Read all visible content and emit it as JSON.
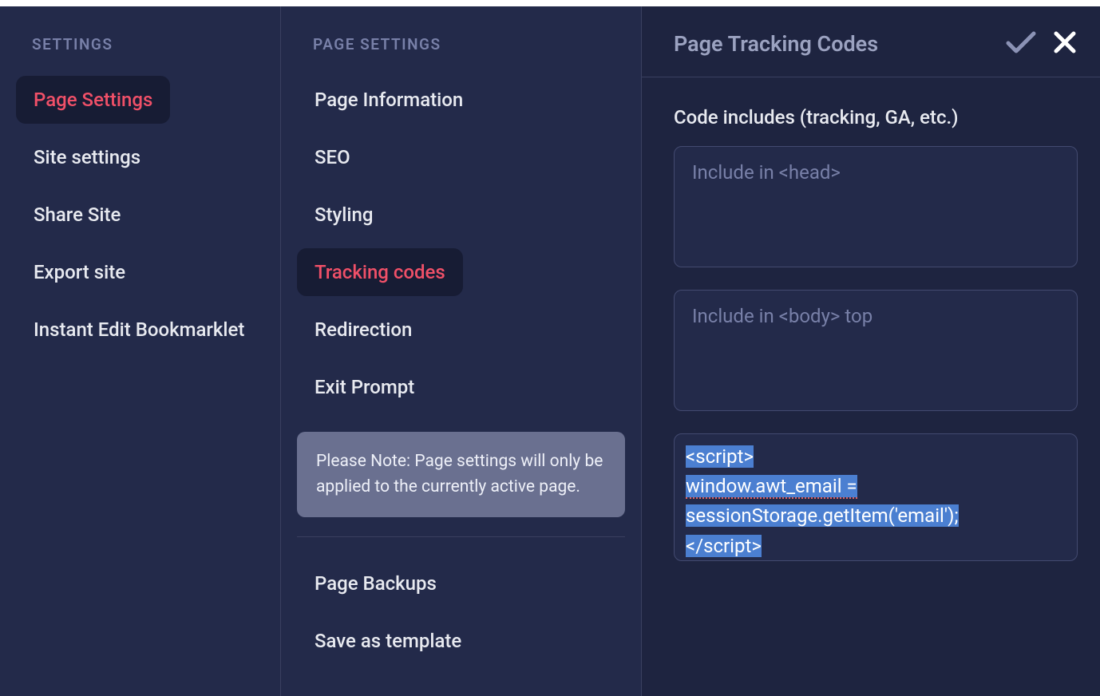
{
  "leftSidebar": {
    "heading": "SETTINGS",
    "items": [
      {
        "label": "Page Settings",
        "active": true
      },
      {
        "label": "Site settings",
        "active": false
      },
      {
        "label": "Share Site",
        "active": false
      },
      {
        "label": "Export site",
        "active": false
      },
      {
        "label": "Instant Edit Bookmarklet",
        "active": false
      }
    ]
  },
  "midSidebar": {
    "heading": "PAGE SETTINGS",
    "itemsTop": [
      {
        "label": "Page Information",
        "active": false
      },
      {
        "label": "SEO",
        "active": false
      },
      {
        "label": "Styling",
        "active": false
      },
      {
        "label": "Tracking codes",
        "active": true
      },
      {
        "label": "Redirection",
        "active": false
      },
      {
        "label": "Exit Prompt",
        "active": false
      }
    ],
    "note": "Please Note: Page settings will only be applied to the currently active page.",
    "itemsBottom": [
      {
        "label": "Page Backups",
        "active": false
      },
      {
        "label": "Save as template",
        "active": false
      }
    ]
  },
  "rightPanel": {
    "title": "Page Tracking Codes",
    "sectionLabel": "Code includes (tracking, GA, etc.)",
    "headPlaceholder": "Include in <head>",
    "bodyTopPlaceholder": "Include in <body> top",
    "headValue": "",
    "bodyTopValue": "",
    "codeLines": [
      "<script>",
      "window.awt_email = ",
      "sessionStorage.getItem('email');",
      "</script>"
    ],
    "codeLineDotted": [
      false,
      true,
      false,
      false
    ]
  }
}
